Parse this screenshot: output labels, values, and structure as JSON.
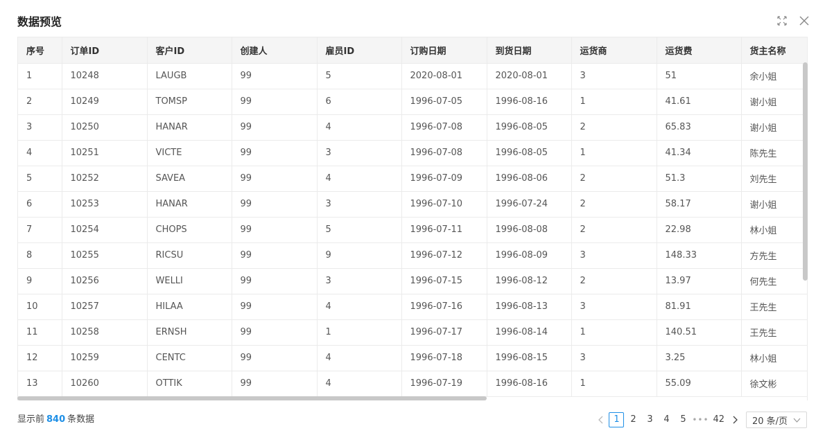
{
  "dialog": {
    "title": "数据预览"
  },
  "table": {
    "columns": [
      "序号",
      "订单ID",
      "客户ID",
      "创建人",
      "雇员ID",
      "订购日期",
      "到货日期",
      "运货商",
      "运货费",
      "货主名称"
    ],
    "rows": [
      [
        "1",
        "10248",
        "LAUGB",
        "99",
        "5",
        "2020-08-01",
        "2020-08-01",
        "3",
        "51",
        "余小姐"
      ],
      [
        "2",
        "10249",
        "TOMSP",
        "99",
        "6",
        "1996-07-05",
        "1996-08-16",
        "1",
        "41.61",
        "谢小姐"
      ],
      [
        "3",
        "10250",
        "HANAR",
        "99",
        "4",
        "1996-07-08",
        "1996-08-05",
        "2",
        "65.83",
        "谢小姐"
      ],
      [
        "4",
        "10251",
        "VICTE",
        "99",
        "3",
        "1996-07-08",
        "1996-08-05",
        "1",
        "41.34",
        "陈先生"
      ],
      [
        "5",
        "10252",
        "SAVEA",
        "99",
        "4",
        "1996-07-09",
        "1996-08-06",
        "2",
        "51.3",
        "刘先生"
      ],
      [
        "6",
        "10253",
        "HANAR",
        "99",
        "3",
        "1996-07-10",
        "1996-07-24",
        "2",
        "58.17",
        "谢小姐"
      ],
      [
        "7",
        "10254",
        "CHOPS",
        "99",
        "5",
        "1996-07-11",
        "1996-08-08",
        "2",
        "22.98",
        "林小姐"
      ],
      [
        "8",
        "10255",
        "RICSU",
        "99",
        "9",
        "1996-07-12",
        "1996-08-09",
        "3",
        "148.33",
        "方先生"
      ],
      [
        "9",
        "10256",
        "WELLI",
        "99",
        "3",
        "1996-07-15",
        "1996-08-12",
        "2",
        "13.97",
        "何先生"
      ],
      [
        "10",
        "10257",
        "HILAA",
        "99",
        "4",
        "1996-07-16",
        "1996-08-13",
        "3",
        "81.91",
        "王先生"
      ],
      [
        "11",
        "10258",
        "ERNSH",
        "99",
        "1",
        "1996-07-17",
        "1996-08-14",
        "1",
        "140.51",
        "王先生"
      ],
      [
        "12",
        "10259",
        "CENTC",
        "99",
        "4",
        "1996-07-18",
        "1996-08-15",
        "3",
        "3.25",
        "林小姐"
      ],
      [
        "13",
        "10260",
        "OTTIK",
        "99",
        "4",
        "1996-07-19",
        "1996-08-16",
        "1",
        "55.09",
        "徐文彬"
      ]
    ]
  },
  "footer": {
    "summary_prefix": "显示前",
    "summary_count": "840",
    "summary_suffix": "条数据"
  },
  "pagination": {
    "pages": [
      "1",
      "2",
      "3",
      "4",
      "5"
    ],
    "ellipsis": "•••",
    "last_page": "42",
    "current": "1",
    "page_size": "20 条/页"
  },
  "colors": {
    "accent": "#1e8fe6",
    "header_bg": "#f5f5f5",
    "border": "#ebebeb"
  }
}
